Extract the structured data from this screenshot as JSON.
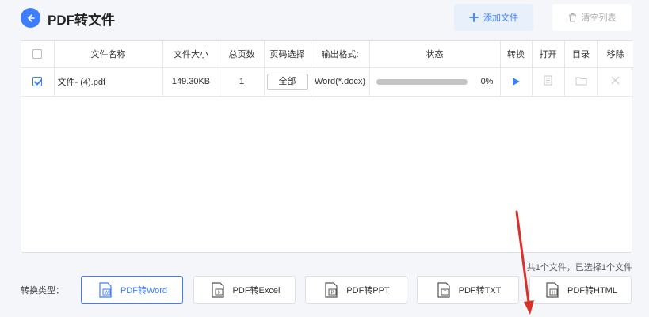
{
  "header": {
    "title": "PDF转文件",
    "add_label": "添加文件",
    "clear_label": "清空列表"
  },
  "table": {
    "columns": [
      "文件名称",
      "文件大小",
      "总页数",
      "页码选择",
      "输出格式:",
      "状态",
      "转换",
      "打开",
      "目录",
      "移除"
    ],
    "rows": [
      {
        "checked": true,
        "name": "文件- (4).pdf",
        "size": "149.30KB",
        "pages": "1",
        "page_select": "全部",
        "format": "Word(*.docx)",
        "progress": 0,
        "percent": "0%"
      }
    ]
  },
  "status_text": "共1个文件，已选择1个文件",
  "conversion": {
    "label": "转换类型：",
    "types": [
      {
        "label": "PDF转Word",
        "icon": "W",
        "active": true
      },
      {
        "label": "PDF转Excel",
        "icon": "X",
        "active": false
      },
      {
        "label": "PDF转PPT",
        "icon": "P",
        "active": false
      },
      {
        "label": "PDF转TXT",
        "icon": "T",
        "active": false
      },
      {
        "label": "PDF转HTML",
        "icon": "H",
        "active": false
      }
    ]
  },
  "colors": {
    "accent": "#3d7eff",
    "annotation": "#d9302a"
  }
}
